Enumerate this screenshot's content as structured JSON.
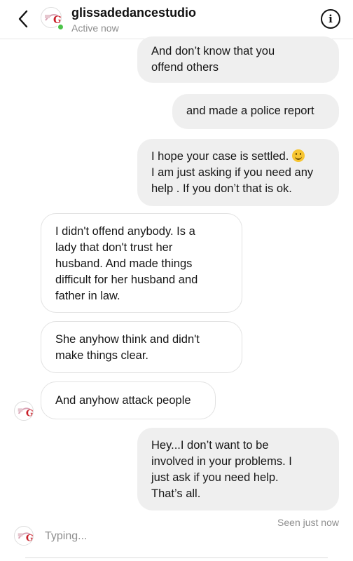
{
  "header": {
    "title": "glissadedancestudio",
    "status": "Active now",
    "info_icon": "info-icon",
    "back_icon": "chevron-left-icon"
  },
  "messages": [
    {
      "direction": "out",
      "text": "And don’t know that you\noffend others"
    },
    {
      "direction": "out",
      "text": "and made a police report"
    },
    {
      "direction": "out",
      "text": "I hope your case is settled.",
      "emoji": "slightly-smiling-face",
      "text2": "I am just asking if you need any\nhelp . If you don’t that is ok."
    },
    {
      "direction": "in",
      "text": "I didn't offend anybody. Is a\nlady that don't trust her\nhusband. And made things\ndifficult for her husband and\nfather in law."
    },
    {
      "direction": "in",
      "text": "She anyhow think and didn't\nmake things clear."
    },
    {
      "direction": "in",
      "text": "And anyhow attack people"
    },
    {
      "direction": "out",
      "text": "Hey...I don’t want to be\ninvolved in your problems. I\njust ask if you need help.\nThat’s all."
    }
  ],
  "footer": {
    "seen": "Seen just now",
    "typing": "Typing..."
  },
  "colors": {
    "outgoing_bubble": "#efefef",
    "incoming_border": "#e2e2e2",
    "online": "#4cc34a",
    "muted_text": "#8e8e8e"
  }
}
